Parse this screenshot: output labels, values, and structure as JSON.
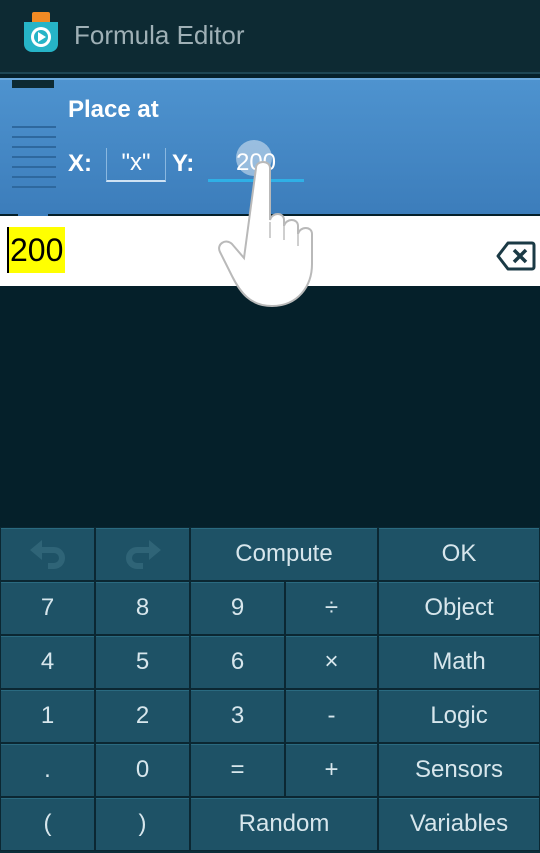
{
  "action_bar": {
    "title": "Formula Editor"
  },
  "brick": {
    "title": "Place at",
    "x_label": "X:",
    "x_value": "\"x\"",
    "y_label": "Y:",
    "y_value": "200"
  },
  "editor": {
    "formula": "200"
  },
  "keyboard": {
    "undo_icon": "undo-icon",
    "redo_icon": "redo-icon",
    "compute": "Compute",
    "ok": "OK",
    "k7": "7",
    "k8": "8",
    "k9": "9",
    "divide": "÷",
    "object": "Object",
    "k4": "4",
    "k5": "5",
    "k6": "6",
    "multiply": "×",
    "math": "Math",
    "k1": "1",
    "k2": "2",
    "k3": "3",
    "minus": "-",
    "logic": "Logic",
    "dot": ".",
    "k0": "0",
    "equals": "=",
    "plus": "+",
    "sensors": "Sensors",
    "lparen": "(",
    "rparen": ")",
    "random": "Random",
    "variables": "Variables"
  },
  "colors": {
    "background": "#05202a",
    "brick": "#4a8fcb",
    "key": "#1e5266",
    "highlight": "#ffff00"
  }
}
